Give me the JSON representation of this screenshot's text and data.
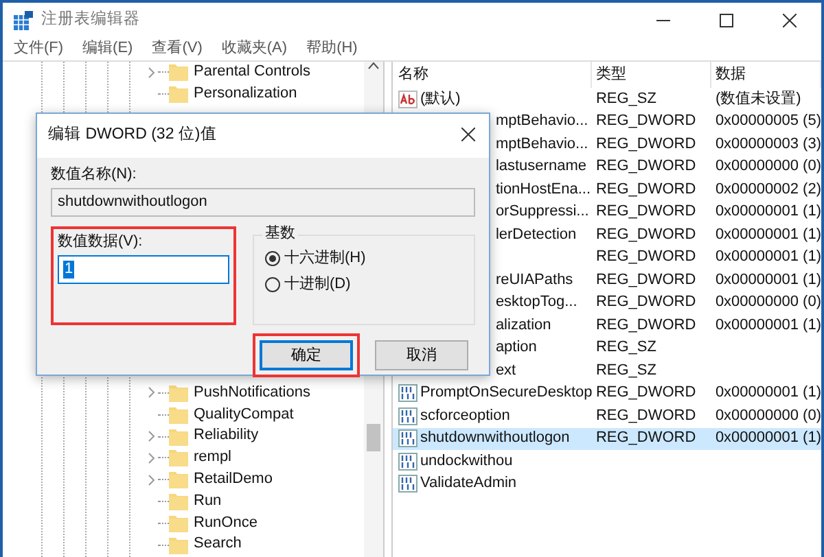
{
  "window": {
    "title": "注册表编辑器"
  },
  "menu": [
    "文件(F)",
    "编辑(E)",
    "查看(V)",
    "收藏夹(A)",
    "帮助(H)"
  ],
  "tree": {
    "items": [
      {
        "label": "Parental Controls",
        "expandable": true
      },
      {
        "label": "Personalization",
        "expandable": false
      },
      {
        "label": "PushNotifications",
        "expandable": true,
        "gap_before": true
      },
      {
        "label": "QualityCompat",
        "expandable": false
      },
      {
        "label": "Reliability",
        "expandable": true
      },
      {
        "label": "rempl",
        "expandable": true
      },
      {
        "label": "RetailDemo",
        "expandable": true
      },
      {
        "label": "Run",
        "expandable": false
      },
      {
        "label": "RunOnce",
        "expandable": false
      },
      {
        "label": "Search",
        "expandable": false
      }
    ]
  },
  "list": {
    "columns": [
      "名称",
      "类型",
      "数据"
    ],
    "rows": [
      {
        "kind": "sz",
        "covered": false,
        "name": "(默认)",
        "type": "REG_SZ",
        "data": "(数值未设置)",
        "selected": false
      },
      {
        "covered": true,
        "name": "mptBehavio...",
        "type": "REG_DWORD",
        "data": "0x00000005 (5)",
        "selected": false
      },
      {
        "covered": true,
        "name": "mptBehavio...",
        "type": "REG_DWORD",
        "data": "0x00000003 (3)",
        "selected": false
      },
      {
        "covered": true,
        "name": "lastusername",
        "type": "REG_DWORD",
        "data": "0x00000000 (0)",
        "selected": false
      },
      {
        "covered": true,
        "name": "tionHostEna...",
        "type": "REG_DWORD",
        "data": "0x00000002 (2)",
        "selected": false
      },
      {
        "covered": true,
        "name": "orSuppressi...",
        "type": "REG_DWORD",
        "data": "0x00000001 (1)",
        "selected": false
      },
      {
        "covered": true,
        "name": "lerDetection",
        "type": "REG_DWORD",
        "data": "0x00000001 (1)",
        "selected": false
      },
      {
        "type": "REG_DWORD",
        "data": "0x00000001 (1)",
        "selected": false
      },
      {
        "covered": true,
        "name": "reUIAPaths",
        "type": "REG_DWORD",
        "data": "0x00000001 (1)",
        "selected": false
      },
      {
        "covered": true,
        "name": "esktopTog...",
        "type": "REG_DWORD",
        "data": "0x00000000 (0)",
        "selected": false
      },
      {
        "covered": true,
        "name": "alization",
        "type": "REG_DWORD",
        "data": "0x00000001 (1)",
        "selected": false
      },
      {
        "covered": true,
        "name": "aption",
        "type": "REG_SZ",
        "selected": false
      },
      {
        "covered": true,
        "name": "ext",
        "type": "REG_SZ",
        "selected": false
      },
      {
        "kind": "dword",
        "covered": false,
        "name": "PromptOnSecureDesktop",
        "type": "REG_DWORD",
        "data": "0x00000001 (1)",
        "selected": false
      },
      {
        "kind": "dword",
        "covered": false,
        "name": "scforceoption",
        "type": "REG_DWORD",
        "data": "0x00000000 (0)",
        "selected": false
      },
      {
        "kind": "dword",
        "covered": false,
        "name": "shutdownwithoutlogon",
        "type": "REG_DWORD",
        "data": "0x00000001 (1)",
        "selected": true
      },
      {
        "kind": "dword",
        "covered": false,
        "name": "undockwithou",
        "selected": false
      },
      {
        "kind": "dword",
        "covered": false,
        "name": "ValidateAdmin",
        "selected": false
      }
    ]
  },
  "dialog": {
    "title": "编辑 DWORD (32 位)值",
    "name_label": "数值名称(N):",
    "name_value": "shutdownwithoutlogon",
    "data_label": "数值数据(V):",
    "data_value": "1",
    "data_highlighted": true,
    "base_label": "基数",
    "radios": [
      {
        "label": "十六进制(H)",
        "selected": true
      },
      {
        "label": "十进制(D)",
        "selected": false
      }
    ],
    "buttons": [
      {
        "label": "确定",
        "default": true,
        "highlighted": true
      },
      {
        "label": "取消",
        "default": false,
        "highlighted": false
      }
    ]
  }
}
